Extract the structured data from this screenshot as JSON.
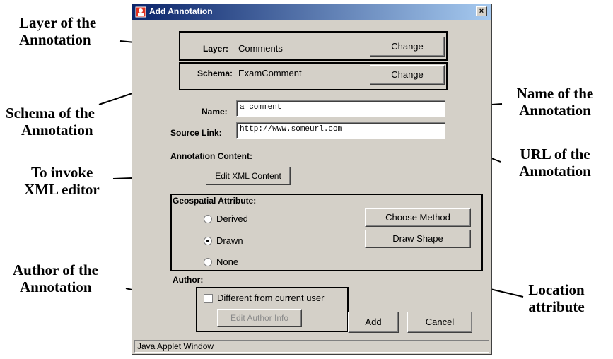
{
  "callouts": {
    "layer": [
      "Layer of the",
      "Annotation"
    ],
    "schema": [
      "Schema of the",
      "Annotation"
    ],
    "xml_editor": [
      "To invoke",
      "XML editor"
    ],
    "author": [
      "Author of the",
      "Annotation"
    ],
    "name": [
      "Name of the",
      "Annotation"
    ],
    "url": [
      "URL of the",
      "Annotation"
    ],
    "location": [
      "Location",
      "attribute"
    ]
  },
  "dialog": {
    "title": "Add Annotation",
    "close_glyph": "×",
    "layer": {
      "label": "Layer:",
      "value": "Comments",
      "button": "Change"
    },
    "schema": {
      "label": "Schema:",
      "value": "ExamComment",
      "button": "Change"
    },
    "name": {
      "label": "Name:",
      "value": "a comment"
    },
    "source_link": {
      "label": "Source Link:",
      "value": "http://www.someurl.com"
    },
    "annotation_content": {
      "label": "Annotation Content:",
      "button": "Edit XML Content"
    },
    "geospatial": {
      "label": "Geospatial Attribute:",
      "options": [
        {
          "label": "Derived",
          "selected": false
        },
        {
          "label": "Drawn",
          "selected": true
        },
        {
          "label": "None",
          "selected": false
        }
      ],
      "choose_method": "Choose Method",
      "draw_shape": "Draw Shape"
    },
    "author": {
      "label": "Author:",
      "checkbox_label": "Different from current user",
      "checked": false,
      "edit_button": "Edit Author Info"
    },
    "add_button": "Add",
    "cancel_button": "Cancel",
    "status": "Java Applet Window"
  }
}
